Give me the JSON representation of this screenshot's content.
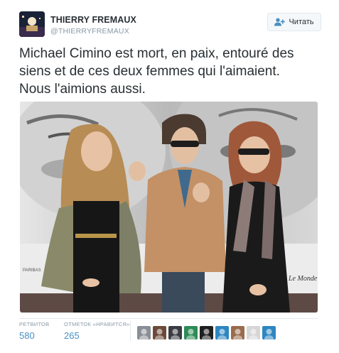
{
  "user": {
    "name": "THIERRY FREMAUX",
    "handle": "@THIERRYFREMAUX"
  },
  "follow_button": {
    "label": "Читать",
    "icon": "add-user-icon"
  },
  "tweet": {
    "text_lines": [
      "Michael Cimino est mort, en paix, entouré des",
      "siens et de ces deux femmes qui l'aimaient.",
      "Nous l'aimions aussi."
    ]
  },
  "photo": {
    "banner_left": "PARIBAS",
    "banner_right": "Le Monde"
  },
  "stats": {
    "retweets": {
      "label": "РЕТВИТОВ",
      "value": "580"
    },
    "likes": {
      "label": "ОТМЕТОК «НРАВИТСЯ»",
      "value": "265"
    }
  },
  "likers": [
    {
      "name": "liker-avatar-1",
      "color": "#8a8f95"
    },
    {
      "name": "liker-avatar-2",
      "color": "#6b4a3a"
    },
    {
      "name": "liker-avatar-3",
      "color": "#3b3b44"
    },
    {
      "name": "liker-avatar-4",
      "color": "#2e8b57"
    },
    {
      "name": "liker-avatar-5",
      "color": "#1f1f1f"
    },
    {
      "name": "liker-avatar-6",
      "color": "#2e86c1"
    },
    {
      "name": "liker-avatar-7",
      "color": "#9a6b4c"
    },
    {
      "name": "liker-avatar-8",
      "color": "#d6d6d6"
    },
    {
      "name": "liker-avatar-9",
      "color": "#2e86c1"
    }
  ],
  "colors": {
    "accent": "#4a8fc2",
    "muted": "#8899a6",
    "text": "#292f33",
    "border": "#e1e8ed"
  }
}
